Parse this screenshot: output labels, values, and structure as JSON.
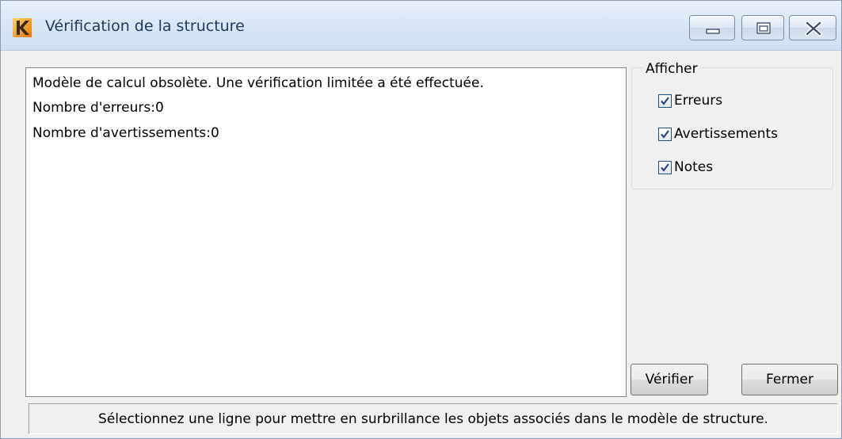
{
  "window": {
    "title": "Vérification de la structure",
    "app_icon": "kiwi-app-icon",
    "controls": {
      "minimize_icon": "minimize-icon",
      "maximize_icon": "maximize-icon",
      "close_icon": "close-icon"
    }
  },
  "results": {
    "lines": [
      "Modèle de calcul obsolète. Une vérification limitée a été effectuée.",
      "Nombre d'erreurs:0",
      "Nombre d'avertissements:0"
    ]
  },
  "filter": {
    "legend": "Afficher",
    "options": [
      {
        "label": "Erreurs",
        "checked": true
      },
      {
        "label": "Avertissements",
        "checked": true
      },
      {
        "label": "Notes",
        "checked": true
      }
    ]
  },
  "buttons": {
    "verify": "Vérifier",
    "close": "Fermer"
  },
  "status": {
    "text": "Sélectionnez une ligne pour mettre en surbrillance les objets associés dans le modèle de structure."
  },
  "colors": {
    "title_text": "#1e395b",
    "app_icon_orange": "#f39c12",
    "checkbox_check": "#2a4a7f"
  }
}
